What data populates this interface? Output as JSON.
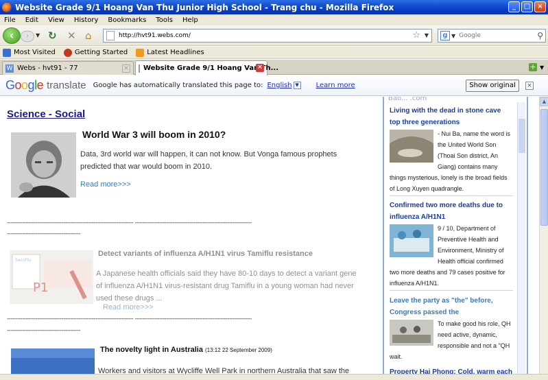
{
  "window": {
    "title": "Website Grade 9/1 Hoang Van Thu Junior High School - Trang chu - Mozilla Firefox",
    "controls": [
      "_",
      "□",
      "×"
    ]
  },
  "menu": [
    "File",
    "Edit",
    "View",
    "History",
    "Bookmarks",
    "Tools",
    "Help"
  ],
  "nav": {
    "url": "http://hvt91.webs.com/",
    "search_placeholder": "Google"
  },
  "bookmarks": [
    "Most Visited",
    "Getting Started",
    "Latest Headlines"
  ],
  "tabs": [
    {
      "label": "Webs - hvt91 - 77"
    },
    {
      "label": "Website Grade 9/1 Hoang Van Th..."
    }
  ],
  "translate": {
    "logo_google": "Google",
    "logo_word": "translate",
    "message": "Google has automatically translated this page to:",
    "language": "English",
    "learn_more": "Learn more",
    "show_original": "Show original"
  },
  "page": {
    "section_title": "Science - Social",
    "divider": "-------------------------------------------------------------------  --------------------------------------------------------------",
    "divider2": "---------------------------------------",
    "articles": [
      {
        "title": "World War 3 will boom in 2010?",
        "body": "Data, 3rd world war will happen, it can not know. But Vonga famous prophets predicted that war would boom in 2010.",
        "more": "Read more>>>"
      },
      {
        "title": "Detect variants of influenza A/H1N1 virus Tamiflu resistance",
        "body": "A Japanese health officials said they have 80-10 days to detect a variant gene of influenza A/H1N1 virus-resistant drug Tamiflu in a young woman had never used these drugs ...",
        "more": "Read more>>>"
      },
      {
        "title": "The novelty light in Australia",
        "date": "(13:12 22 September 2009)",
        "body": "Workers and visitors at Wycliffe Well Park in northern Australia that saw the"
      }
    ]
  },
  "sidebar": {
    "header": "Bao... .com",
    "items": [
      {
        "title": "Living with the dead in stone cave top three generations",
        "text": "- Nui Ba, name the word is the United World Son (Thoai Son district, An Giang) contains many things mysterious, lonely is the broad fields of Long Xuyen quadrangle."
      },
      {
        "title": "Confirmed two more deaths due to influenza A/H1N1",
        "text": "9 / 10, Department of Preventive Health and Environment, Ministry of Health official confirmed two more deaths and 79 cases positive for influenza A/H1N1."
      },
      {
        "title": "Leave the party as \"the\" before, Congress passed the",
        "text": "To make good his role, QH need active, dynamic, responsible and not a \"QH wait."
      },
      {
        "title": "Property Hai Phong: Cold, warm each"
      }
    ]
  },
  "colors": {
    "titlebar": "#0a3fc4",
    "link": "#1a3c9e",
    "section": "#1a1a8c",
    "read_more": "#3a7ab8"
  }
}
